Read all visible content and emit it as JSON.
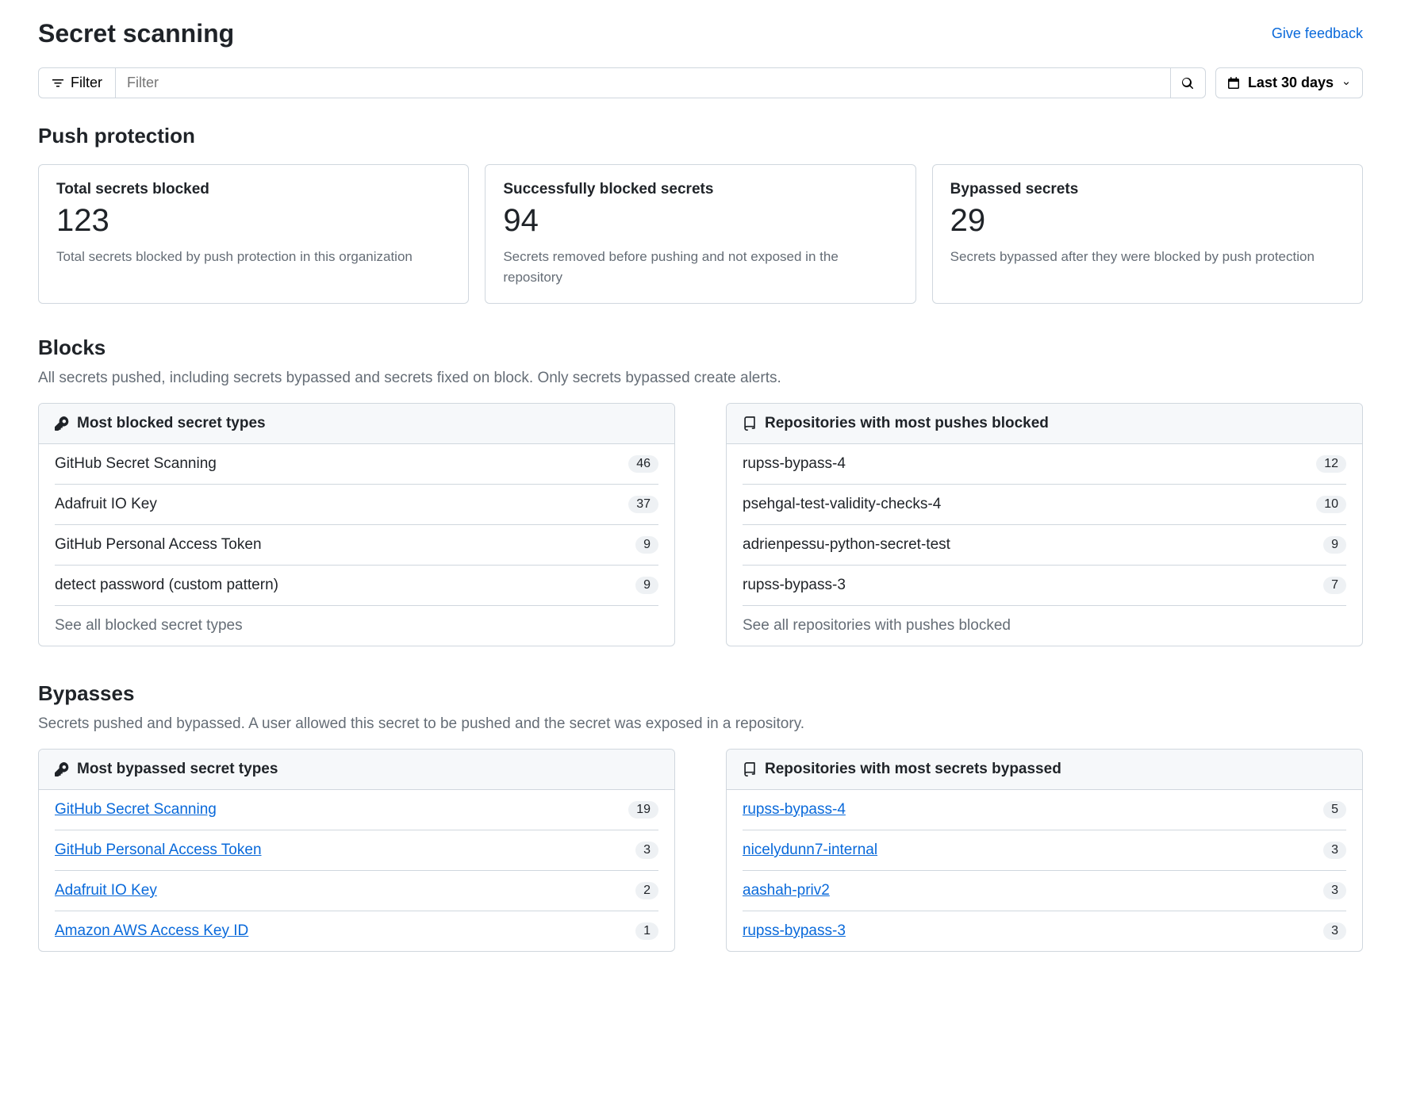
{
  "header": {
    "title": "Secret scanning",
    "feedback": "Give feedback"
  },
  "filters": {
    "filter_label": "Filter",
    "placeholder": "Filter",
    "date_label": "Last 30 days"
  },
  "push_protection": {
    "title": "Push protection",
    "cards": [
      {
        "label": "Total secrets blocked",
        "value": "123",
        "desc": "Total secrets blocked by push protection in this organization"
      },
      {
        "label": "Successfully blocked secrets",
        "value": "94",
        "desc": "Secrets removed before pushing and not exposed in the repository"
      },
      {
        "label": "Bypassed secrets",
        "value": "29",
        "desc": "Secrets bypassed after they were blocked by push protection"
      }
    ]
  },
  "blocks": {
    "title": "Blocks",
    "desc": "All secrets pushed, including secrets bypassed and secrets fixed on block. Only secrets bypassed create alerts.",
    "panel_a": {
      "title": "Most blocked secret types",
      "rows": [
        {
          "name": "GitHub Secret Scanning",
          "count": "46"
        },
        {
          "name": "Adafruit IO Key",
          "count": "37"
        },
        {
          "name": "GitHub Personal Access Token",
          "count": "9"
        },
        {
          "name": "detect password (custom pattern)",
          "count": "9"
        }
      ],
      "see_all": "See all blocked secret types"
    },
    "panel_b": {
      "title": "Repositories with most pushes blocked",
      "rows": [
        {
          "name": "rupss-bypass-4",
          "count": "12"
        },
        {
          "name": "psehgal-test-validity-checks-4",
          "count": "10"
        },
        {
          "name": "adrienpessu-python-secret-test",
          "count": "9"
        },
        {
          "name": "rupss-bypass-3",
          "count": "7"
        }
      ],
      "see_all": "See all repositories with pushes blocked"
    }
  },
  "bypasses": {
    "title": "Bypasses",
    "desc": "Secrets pushed and bypassed. A user allowed this secret to be pushed and the secret was exposed in a repository.",
    "panel_a": {
      "title": "Most bypassed secret types",
      "rows": [
        {
          "name": "GitHub Secret Scanning",
          "count": "19"
        },
        {
          "name": "GitHub Personal Access Token",
          "count": "3"
        },
        {
          "name": "Adafruit IO Key",
          "count": "2"
        },
        {
          "name": "Amazon AWS Access Key ID",
          "count": "1"
        }
      ]
    },
    "panel_b": {
      "title": "Repositories with most secrets bypassed",
      "rows": [
        {
          "name": "rupss-bypass-4",
          "count": "5"
        },
        {
          "name": "nicelydunn7-internal",
          "count": "3"
        },
        {
          "name": "aashah-priv2",
          "count": "3"
        },
        {
          "name": "rupss-bypass-3",
          "count": "3"
        }
      ]
    }
  }
}
